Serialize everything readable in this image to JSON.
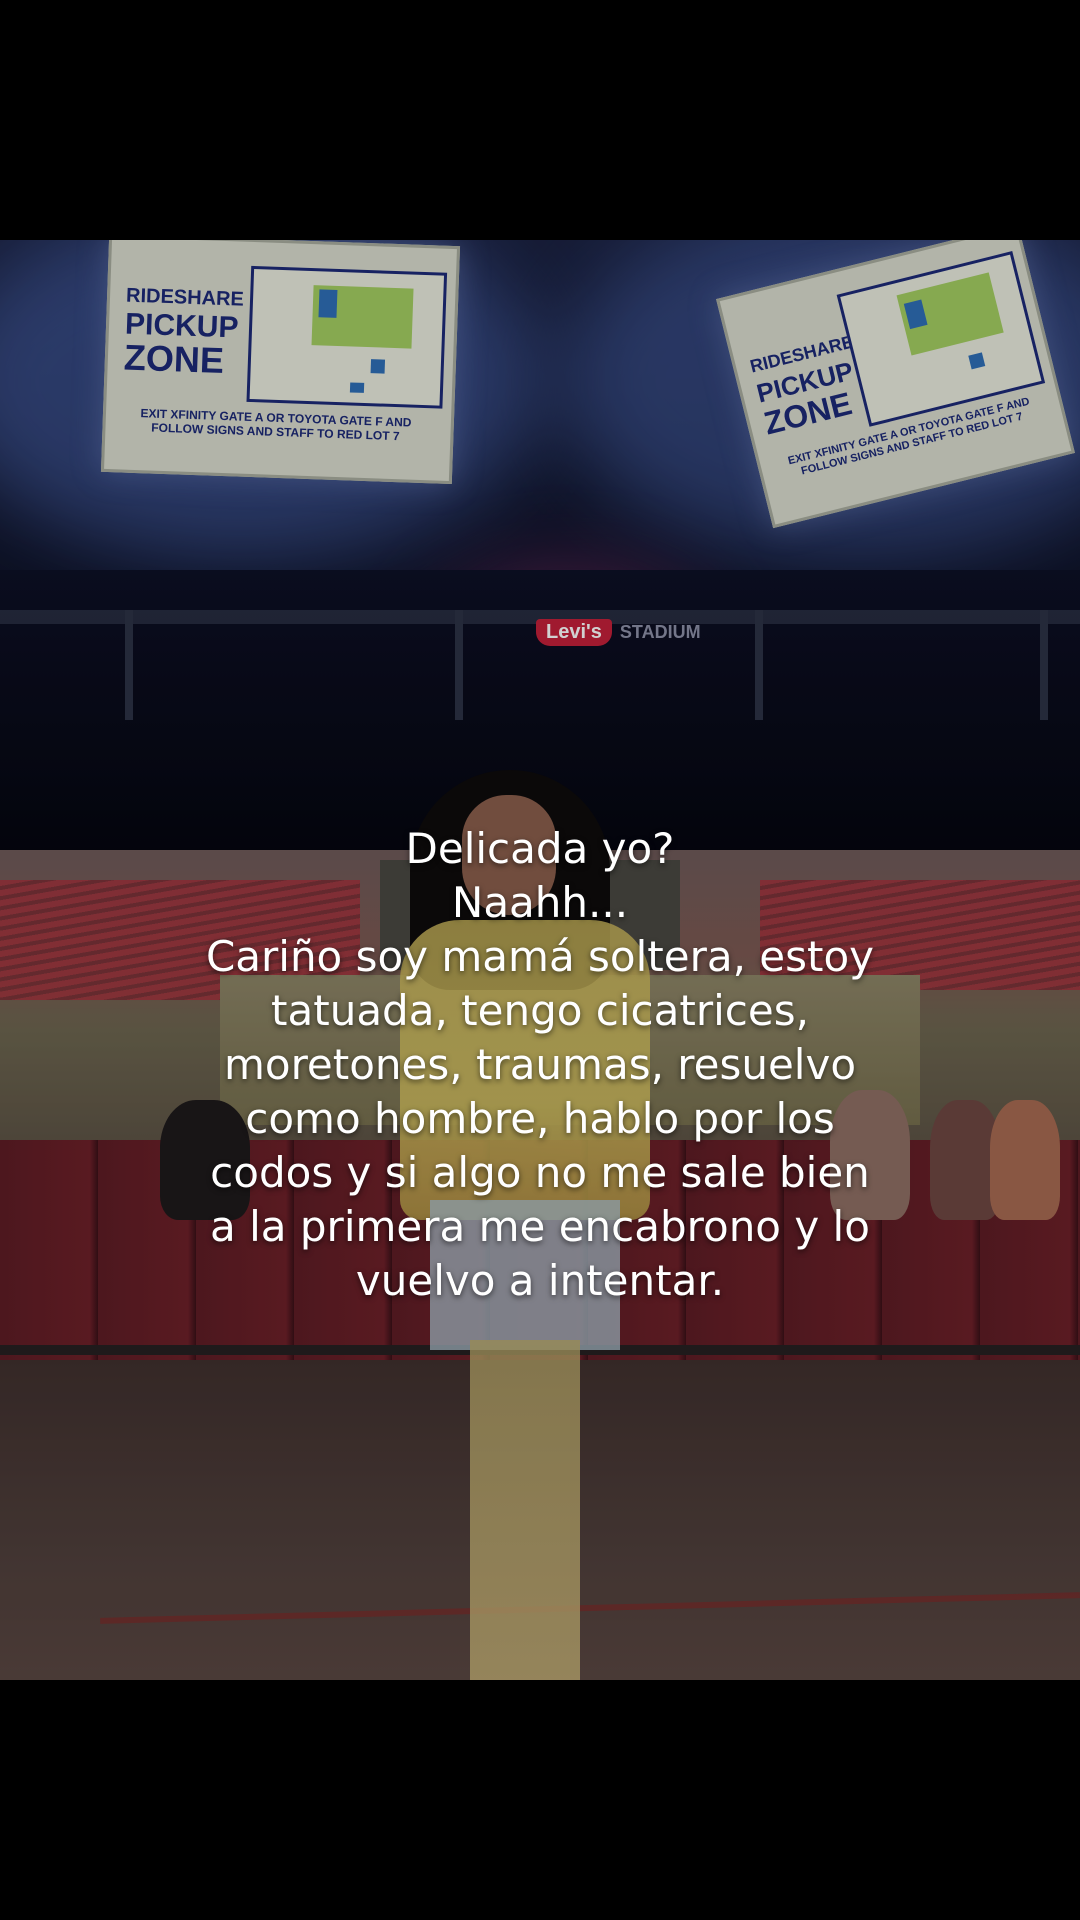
{
  "photo": {
    "signs": [
      {
        "title_lines": [
          "RIDESHARE",
          "PICKUP",
          "ZONE"
        ],
        "footer": "EXIT XFINITY GATE A OR TOYOTA GATE F AND FOLLOW SIGNS AND STAFF TO RED LOT 7"
      },
      {
        "title_lines": [
          "RIDESHARE",
          "PICKUP",
          "ZONE"
        ],
        "footer": "EXIT XFINITY GATE A OR TOYOTA GATE F AND FOLLOW SIGNS AND STAFF TO RED LOT 7"
      }
    ],
    "stadium_logo_badge": "Levi's",
    "stadium_logo_word": "STADIUM"
  },
  "caption": {
    "text": "Delicada yo?\nNaahh...\nCariño soy mamá soltera, estoy tatuada, tengo cicatrices, moretones, traumas, resuelvo como hombre, hablo por los codos y si algo no me sale bien a la primera me encabrono y lo vuelvo a intentar."
  }
}
